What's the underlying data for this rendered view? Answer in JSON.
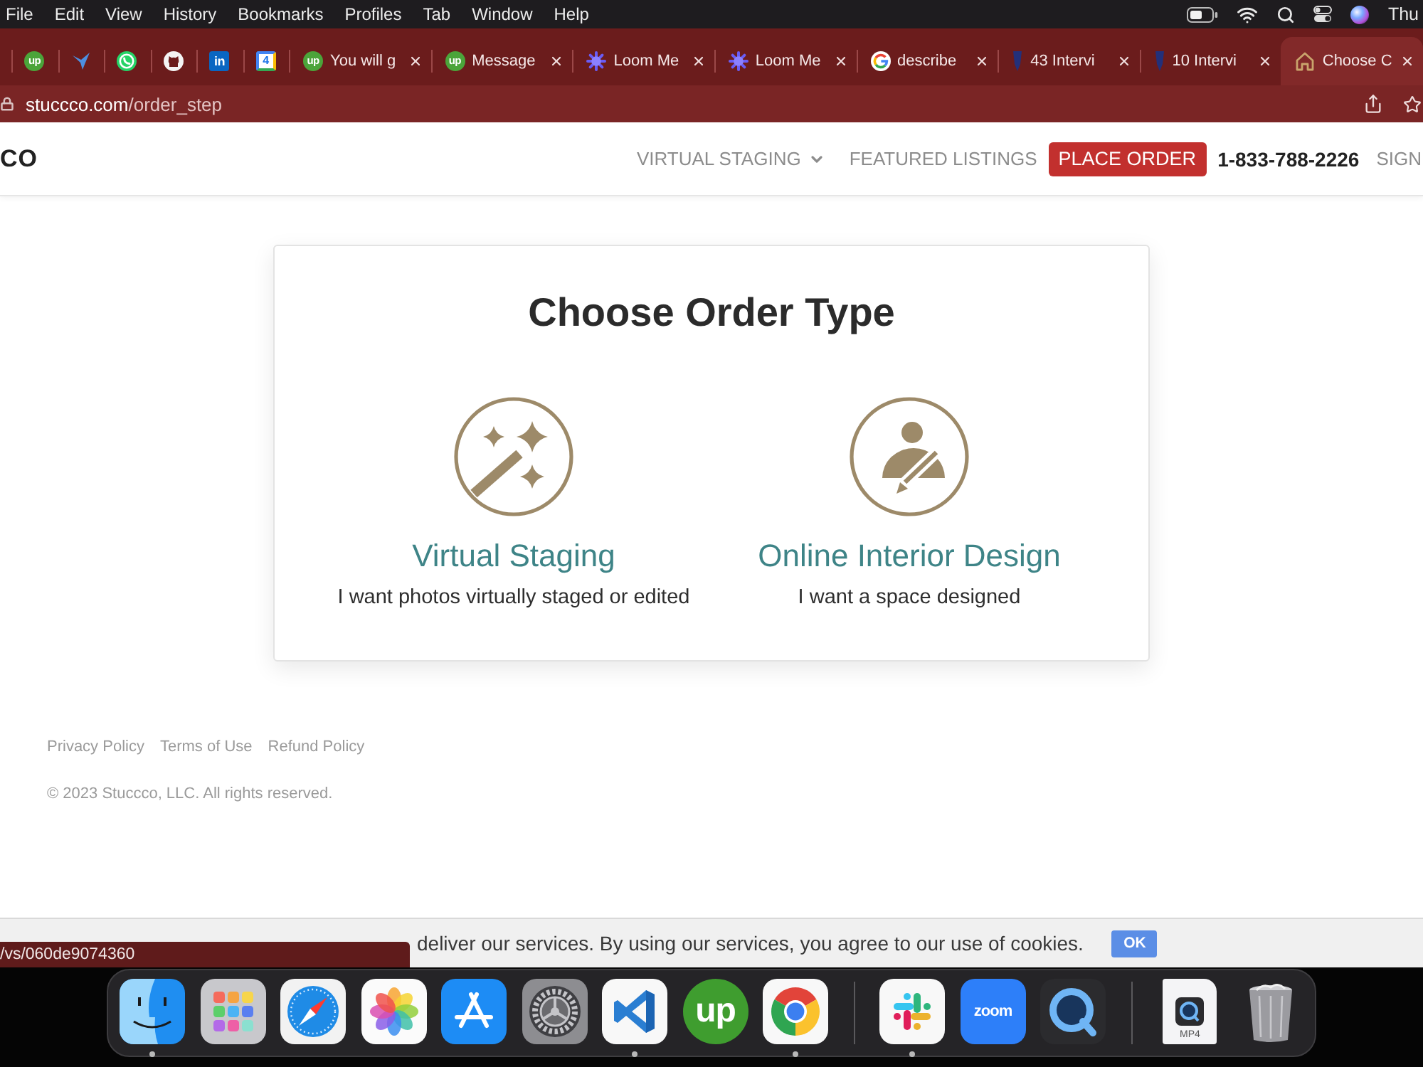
{
  "menu_bar": {
    "items": [
      "File",
      "Edit",
      "View",
      "History",
      "Bookmarks",
      "Profiles",
      "Tab",
      "Window",
      "Help"
    ],
    "clock": "Thu"
  },
  "tab_strip": {
    "pinned": [
      {
        "kind": "upwork",
        "glyph": "up",
        "selected": false
      },
      {
        "kind": "bird",
        "selected": false
      },
      {
        "kind": "whatsapp",
        "selected": false
      },
      {
        "kind": "github",
        "selected": false
      },
      {
        "kind": "linkedin",
        "glyph": "in",
        "selected": false
      },
      {
        "kind": "calendar",
        "glyph": "4",
        "selected": false
      }
    ],
    "tabs": [
      {
        "kind": "upwork",
        "glyph": "up",
        "title": "You will g",
        "selected": false
      },
      {
        "kind": "upwork",
        "glyph": "up",
        "title": "Message",
        "selected": false
      },
      {
        "kind": "loom",
        "title": "Loom Me",
        "selected": false
      },
      {
        "kind": "loom",
        "title": "Loom Me",
        "selected": false
      },
      {
        "kind": "google",
        "title": "describe",
        "selected": false
      },
      {
        "kind": "marker",
        "title": "43 Intervi",
        "selected": false
      },
      {
        "kind": "marker",
        "title": "10 Intervi",
        "selected": false
      },
      {
        "kind": "house",
        "title": "Choose C",
        "selected": true
      }
    ]
  },
  "address_bar": {
    "domain": "stuccco.com",
    "path": "/order_step"
  },
  "site_header": {
    "logo": "CO",
    "nav": [
      {
        "kind": "dropdown",
        "label": "VIRTUAL STAGING"
      },
      {
        "kind": "link",
        "label": "FEATURED LISTINGS"
      },
      {
        "kind": "button",
        "label": "PLACE ORDER"
      },
      {
        "kind": "phone",
        "label": "1-833-788-2226"
      },
      {
        "kind": "link",
        "label": "SIGN"
      }
    ]
  },
  "order_card": {
    "title": "Choose Order Type",
    "options": [
      {
        "kind": "staging",
        "title": "Virtual Staging",
        "description": "I want photos virtually staged or edited"
      },
      {
        "kind": "design",
        "title": "Online Interior Design",
        "description": "I want a space designed"
      }
    ]
  },
  "footer": {
    "links": [
      "Privacy Policy",
      "Terms of Use",
      "Refund Policy"
    ],
    "copyright": "© 2023 Stuccco, LLC. All rights reserved."
  },
  "cookie_bar": {
    "message": "deliver our services. By using our services, you agree to our use of cookies.",
    "button": "OK"
  },
  "status_url": "/vs/060de9074360",
  "dock": {
    "sections": [
      {
        "items": [
          {
            "kind": "finder",
            "running": true
          },
          {
            "kind": "launchpad",
            "running": false
          },
          {
            "kind": "safari",
            "running": false
          },
          {
            "kind": "photos",
            "running": false
          },
          {
            "kind": "appstore",
            "running": false
          },
          {
            "kind": "settings",
            "running": false
          },
          {
            "kind": "vscode",
            "running": true
          },
          {
            "kind": "upwork",
            "label": "up",
            "running": false
          },
          {
            "kind": "chrome",
            "running": true
          }
        ]
      },
      {
        "items": [
          {
            "kind": "slack",
            "running": true
          },
          {
            "kind": "zoom",
            "label": "zoom",
            "running": false
          },
          {
            "kind": "quicktime",
            "running": false
          }
        ]
      },
      {
        "items": [
          {
            "kind": "file",
            "label": "MP4",
            "running": false
          },
          {
            "kind": "trash",
            "running": false
          }
        ]
      }
    ]
  }
}
